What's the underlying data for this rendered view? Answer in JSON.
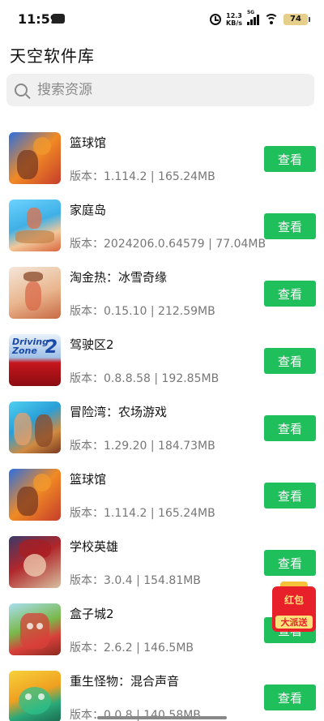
{
  "status_bar": {
    "time": "11:59",
    "speed_value": "12.3",
    "speed_unit": "KB/s",
    "network": "5G",
    "battery": "74"
  },
  "page": {
    "title": "天空软件库"
  },
  "search": {
    "placeholder": "搜索资源",
    "value": ""
  },
  "apps": [
    {
      "name": "篮球馆",
      "meta": "版本：1.114.2 | 165.24MB",
      "button": "查看"
    },
    {
      "name": "家庭岛",
      "meta": "版本：2024206.0.64579 | 77.04MB",
      "button": "查看"
    },
    {
      "name": "淘金热：冰雪奇缘",
      "meta": "版本：0.15.10 | 212.59MB",
      "button": "查看"
    },
    {
      "name": "驾驶区2",
      "meta": "版本：0.8.8.58 | 192.85MB",
      "button": "查看"
    },
    {
      "name": "冒险湾：农场游戏",
      "meta": "版本：1.29.20 | 184.73MB",
      "button": "查看"
    },
    {
      "name": "篮球馆",
      "meta": "版本：1.114.2 | 165.24MB",
      "button": "查看"
    },
    {
      "name": "学校英雄",
      "meta": "版本：3.0.4 | 154.81MB",
      "button": "查看"
    },
    {
      "name": "盒子城2",
      "meta": "版本：2.6.2 | 146.5MB",
      "button": "查看"
    },
    {
      "name": "重生怪物：混合声音",
      "meta": "版本：0.0.8 | 140.58MB",
      "button": "查看"
    }
  ],
  "thumb_texts": {
    "driving_zone": "Driving Zone",
    "driving_zone_num": "2"
  },
  "promo": {
    "line1": "红包",
    "line2": "大派送"
  },
  "colors": {
    "accent_green": "#1fc05c",
    "promo_red": "#e8202a"
  }
}
